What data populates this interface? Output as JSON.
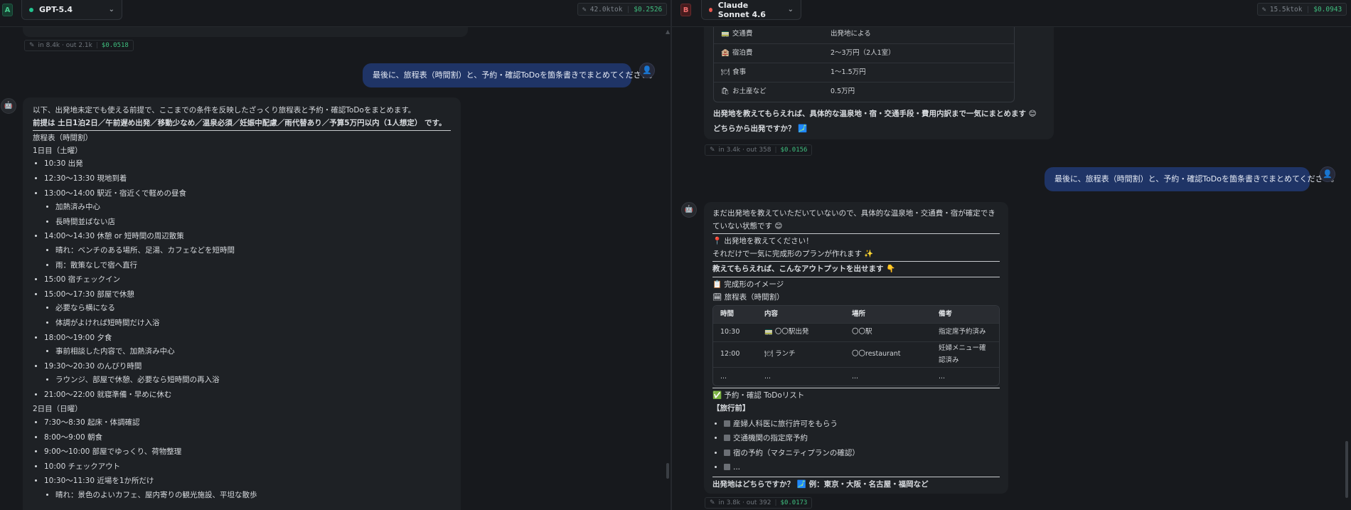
{
  "left": {
    "badge": "A",
    "model": "GPT-5.4",
    "model_dot_color": "#22c38e",
    "stats": {
      "tokens": "42.0ktok",
      "cost": "$0.2526"
    },
    "prev_meta": {
      "io": "in 8.4k · out 2.1k",
      "cost": "$0.0518"
    },
    "user_message": "最後に、旅程表（時間割）と、予約・確認ToDoを箇条書きでまとめてください。",
    "reply": {
      "intro1": "以下、出発地未定でも使える前提で、ここまでの条件を反映したざっくり旅程表と予約・確認ToDoをまとめます。",
      "intro2": "前提は 土日1泊2日／午前遅め出発／移動少なめ／温泉必須／妊娠中配慮／雨代替あり／予算5万円以内（1人想定） です。",
      "heading": "旅程表（時間割）",
      "day1_title": "1日目（土曜）",
      "day1": [
        {
          "text": "10:30 出発",
          "sub": []
        },
        {
          "text": "12:30〜13:30 現地到着",
          "sub": []
        },
        {
          "text": "13:00〜14:00 駅近・宿近くで軽めの昼食",
          "sub": [
            "加熱済み中心",
            "長時間並ばない店"
          ]
        },
        {
          "text": "14:00〜14:30 休憩 or 短時間の周辺散策",
          "sub": [
            "晴れ：ベンチのある場所、足湯、カフェなどを短時間",
            "雨：散策なしで宿へ直行"
          ]
        },
        {
          "text": "15:00 宿チェックイン",
          "sub": []
        },
        {
          "text": "15:00〜17:30 部屋で休憩",
          "sub": [
            "必要なら横になる",
            "体調がよければ短時間だけ入浴"
          ]
        },
        {
          "text": "18:00〜19:00 夕食",
          "sub": [
            "事前相談した内容で、加熱済み中心"
          ]
        },
        {
          "text": "19:30〜20:30 のんびり時間",
          "sub": [
            "ラウンジ、部屋で休憩、必要なら短時間の再入浴"
          ]
        },
        {
          "text": "21:00〜22:00 就寝準備・早めに休む",
          "sub": []
        }
      ],
      "day2_title": "2日目（日曜）",
      "day2": [
        {
          "text": "7:30〜8:30 起床・体調確認",
          "sub": []
        },
        {
          "text": "8:00〜9:00 朝食",
          "sub": []
        },
        {
          "text": "9:00〜10:00 部屋でゆっくり、荷物整理",
          "sub": []
        },
        {
          "text": "10:00 チェックアウト",
          "sub": []
        },
        {
          "text": "10:30〜11:30 近場を1か所だけ",
          "sub": [
            "晴れ：景色のよいカフェ、屋内寄りの観光施設、平坦な散歩"
          ]
        }
      ]
    }
  },
  "right": {
    "badge": "B",
    "model": "Claude Sonnet 4.6",
    "model_dot_color": "#e8584f",
    "stats": {
      "tokens": "15.5ktok",
      "cost": "$0.0943"
    },
    "prev_rows": [
      {
        "icon": "🚃",
        "label": "交通費",
        "value": "出発地による"
      },
      {
        "icon": "🏨",
        "label": "宿泊費",
        "value": "2〜3万円（2人1室）"
      },
      {
        "icon": "🍽",
        "label": "食事",
        "value": "1〜1.5万円"
      },
      {
        "icon": "🛍",
        "label": "お土産など",
        "value": "0.5万円"
      }
    ],
    "prev_text1": "出発地を教えてもらえれば、具体的な温泉地・宿・交通手段・費用内訳まで一気にまとめます 😊",
    "prev_text2": "どちらから出発ですか？ 🗾",
    "prev_meta": {
      "io": "in 3.4k · out 358",
      "cost": "$0.0156"
    },
    "user_message": "最後に、旅程表（時間割）と、予約・確認ToDoを箇条書きでまとめてください。",
    "reply": {
      "intro": "まだ出発地を教えていただいていないので、具体的な温泉地・交通費・宿が確定できていない状態です 😊",
      "ask1": "📍 出発地を教えてください！",
      "ask2": "それだけで一気に完成形のプランが作れます ✨",
      "output_line": "教えてもらえれば、こんなアウトプットを出せます 👇",
      "image_title": "📋 完成形のイメージ",
      "table_title": "🗓 旅程表（時間割）",
      "table_headers": [
        "時間",
        "内容",
        "場所",
        "備考"
      ],
      "table_rows": [
        [
          "10:30",
          "🚃 〇〇駅出発",
          "〇〇駅",
          "指定席予約済み"
        ],
        [
          "12:00",
          "🍽 ランチ",
          "〇〇restaurant",
          "妊婦メニュー確認済み"
        ],
        [
          "...",
          "...",
          "...",
          "..."
        ]
      ],
      "todo_title": "✅ 予約・確認 ToDoリスト",
      "todo_sub": "【旅行前】",
      "todos": [
        "産婦人科医に旅行許可をもらう",
        "交通機関の指定席予約",
        "宿の予約（マタニティプランの確認）",
        "..."
      ],
      "closing": "出発地はどちらですか？ 🗾 例：東京・大阪・名古屋・福岡など"
    },
    "meta": {
      "io": "in 3.8k · out 392",
      "cost": "$0.0173"
    }
  }
}
